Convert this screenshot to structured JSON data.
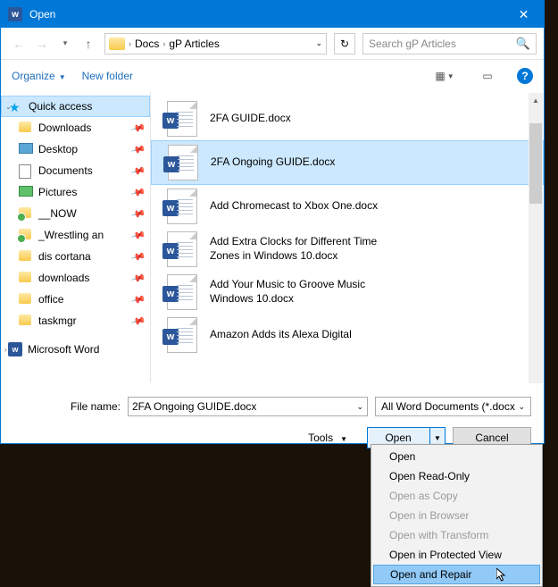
{
  "window": {
    "title": "Open"
  },
  "nav": {
    "path1": "Docs",
    "path2": "gP Articles",
    "search_placeholder": "Search gP Articles"
  },
  "toolbar": {
    "organize": "Organize",
    "newfolder": "New folder"
  },
  "sidebar": {
    "items": [
      {
        "label": "Quick access"
      },
      {
        "label": "Downloads"
      },
      {
        "label": "Desktop"
      },
      {
        "label": "Documents"
      },
      {
        "label": "Pictures"
      },
      {
        "label": "__NOW"
      },
      {
        "label": "_Wrestling an"
      },
      {
        "label": "dis cortana"
      },
      {
        "label": "downloads"
      },
      {
        "label": "office"
      },
      {
        "label": "taskmgr"
      },
      {
        "label": "Microsoft Word"
      }
    ]
  },
  "files": [
    {
      "name": "2FA GUIDE.docx"
    },
    {
      "name": "2FA Ongoing GUIDE.docx"
    },
    {
      "name": "Add Chromecast to Xbox One.docx"
    },
    {
      "name": "Add Extra Clocks for Different Time Zones in Windows 10.docx"
    },
    {
      "name": "Add Your Music to Groove Music Windows 10.docx"
    },
    {
      "name": "Amazon Adds its Alexa Digital"
    }
  ],
  "footer": {
    "filename_label": "File name:",
    "filename_value": "2FA Ongoing GUIDE.docx",
    "filter": "All Word Documents (*.docx;*.d",
    "tools": "Tools",
    "open": "Open",
    "cancel": "Cancel"
  },
  "menu": {
    "items": [
      {
        "label": "Open",
        "enabled": true
      },
      {
        "label": "Open Read-Only",
        "enabled": true
      },
      {
        "label": "Open as Copy",
        "enabled": false
      },
      {
        "label": "Open in Browser",
        "enabled": false
      },
      {
        "label": "Open with Transform",
        "enabled": false
      },
      {
        "label": "Open in Protected View",
        "enabled": true
      },
      {
        "label": "Open and Repair",
        "enabled": true
      }
    ]
  }
}
